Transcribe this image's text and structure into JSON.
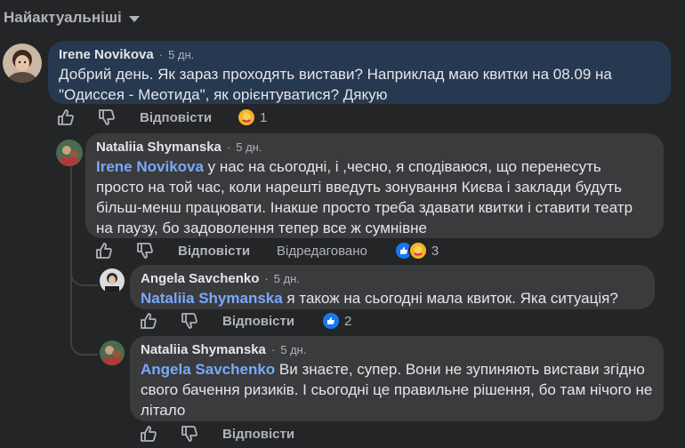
{
  "sort": {
    "label": "Найактуальніші",
    "icon": "chevron-down-icon"
  },
  "comments": [
    {
      "author": "Irene Novikova",
      "time": "5 дн.",
      "text": "Добрий день. Як зараз проходять вистави? Наприклад маю квитки на 08.09 на \"Одиссея - Меотида\", як орієнтуватися? Дякую",
      "actions": {
        "reply": "Відповісти",
        "reactions_count": "1"
      }
    },
    {
      "author": "Nataliia Shymanska",
      "time": "5 дн.",
      "mention": "Irene Novikova",
      "text": " у нас на сьогодні, і ,чесно, я сподіваюся, що перенесуть просто на той час, коли нарешті введуть зонування Києва і заклади будуть більш-менш працювати. Інакше просто треба здавати квитки і ставити театр на паузу, бо задоволення тепер все ж сумнівне",
      "actions": {
        "reply": "Відповісти",
        "edited": "Відредаговано",
        "reactions_count": "3"
      }
    },
    {
      "author": "Angela Savchenko",
      "time": "5 дн.",
      "mention": "Nataliia Shymanska",
      "text": " я також на сьогодні мала квиток. Яка ситуація?",
      "actions": {
        "reply": "Відповісти",
        "reactions_count": "2"
      }
    },
    {
      "author": "Nataliia Shymanska",
      "time": "5 дн.",
      "mention": "Angela Savchenko",
      "text": " Ви знаєте, супер. Вони не зупиняють вистави згідно свого бачення ризиків. І сьогодні це правильне рішення, бо там нічого не літало",
      "actions": {
        "reply": "Відповісти"
      }
    }
  ],
  "colors": {
    "background": "#242526",
    "bubble": "#3a3b3c",
    "bubble_highlight": "#263951",
    "mention": "#7aa8ff",
    "like": "#1877f2"
  }
}
